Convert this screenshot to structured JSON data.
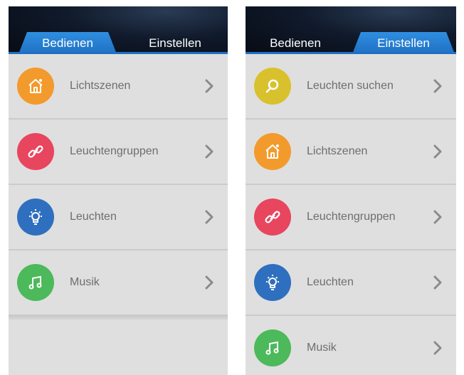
{
  "screens": [
    {
      "tabs": {
        "active": "Bedienen",
        "inactive": "Einstellen"
      },
      "items": [
        {
          "label": "Lichtszenen",
          "icon": "home-icon",
          "color": "#f39a2c"
        },
        {
          "label": "Leuchtengruppen",
          "icon": "link-icon",
          "color": "#e8455f"
        },
        {
          "label": "Leuchten",
          "icon": "bulb-icon",
          "color": "#2f6fbf"
        },
        {
          "label": "Musik",
          "icon": "music-icon",
          "color": "#4cb95a"
        }
      ]
    },
    {
      "tabs": {
        "inactive": "Bedienen",
        "active": "Einstellen"
      },
      "items": [
        {
          "label": "Leuchten suchen",
          "icon": "search-icon",
          "color": "#d8c12c"
        },
        {
          "label": "Lichtszenen",
          "icon": "home-icon",
          "color": "#f39a2c"
        },
        {
          "label": "Leuchtengruppen",
          "icon": "link-icon",
          "color": "#e8455f"
        },
        {
          "label": "Leuchten",
          "icon": "bulb-icon",
          "color": "#2f6fbf"
        },
        {
          "label": "Musik",
          "icon": "music-icon",
          "color": "#4cb95a"
        }
      ]
    }
  ]
}
